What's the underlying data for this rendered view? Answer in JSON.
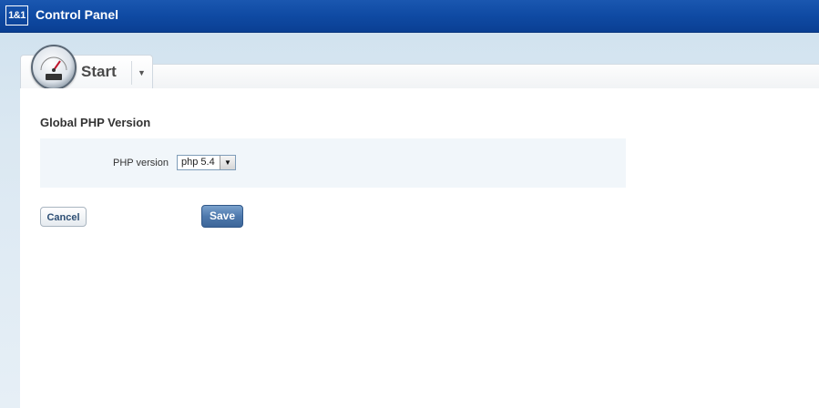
{
  "header": {
    "logo_text": "1&1",
    "title": "Control Panel"
  },
  "tab": {
    "label": "Start",
    "icon": "dashboard-gauge-icon",
    "dropdown_icon": "chevron-down-icon"
  },
  "section": {
    "title": "Global PHP Version"
  },
  "form": {
    "php_label": "PHP version",
    "php_value": "php 5.4"
  },
  "actions": {
    "cancel_label": "Cancel",
    "save_label": "Save"
  },
  "colors": {
    "header_blue": "#0f4aa3",
    "save_button": "#4e79ad",
    "form_bg": "#f1f6fa"
  }
}
